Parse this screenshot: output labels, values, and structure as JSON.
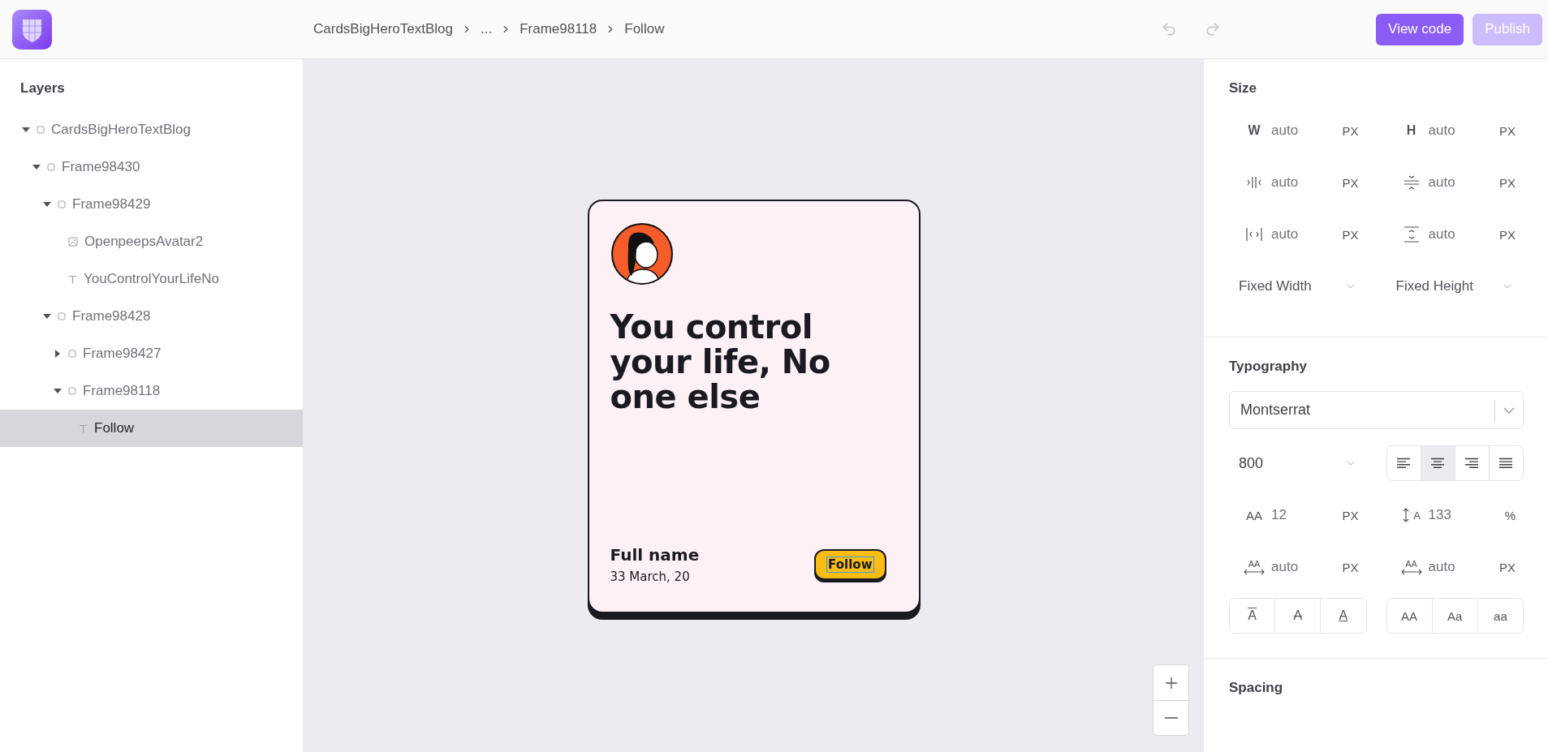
{
  "topbar": {
    "breadcrumbs": [
      "CardsBigHeroTextBlog",
      "...",
      "Frame98118",
      "Follow"
    ],
    "history": [
      {
        "kind": "undo",
        "disabled": true
      },
      {
        "kind": "redo",
        "disabled": true
      }
    ],
    "buttons": [
      {
        "label": "View code",
        "disabled": false
      },
      {
        "label": "Publish",
        "disabled": true
      }
    ]
  },
  "layers": {
    "title": "Layers",
    "items": [
      {
        "label": "CardsBigHeroTextBlog",
        "kind": "frame",
        "expanded": true,
        "selected": false,
        "children": [
          {
            "label": "Frame98430",
            "kind": "frame",
            "expanded": true,
            "selected": false,
            "children": [
              {
                "label": "Frame98429",
                "kind": "frame",
                "expanded": true,
                "selected": false,
                "children": [
                  {
                    "label": "OpenpeepsAvatar2",
                    "kind": "image",
                    "selected": false
                  },
                  {
                    "label": "YouControlYourLifeNo",
                    "kind": "text",
                    "selected": false
                  }
                ]
              },
              {
                "label": "Frame98428",
                "kind": "frame",
                "expanded": true,
                "selected": false,
                "children": [
                  {
                    "label": "Frame98427",
                    "kind": "frame",
                    "expanded": false,
                    "selected": false
                  },
                  {
                    "label": "Frame98118",
                    "kind": "frame",
                    "expanded": true,
                    "selected": false,
                    "children": [
                      {
                        "label": "Follow",
                        "kind": "text",
                        "selected": true
                      }
                    ]
                  }
                ]
              }
            ]
          }
        ]
      }
    ]
  },
  "card": {
    "heading": "You control your life, No one else",
    "name": "Full name",
    "date": "33 March, 20",
    "button": "Follow"
  },
  "zoom": [
    {
      "kind": "plus"
    },
    {
      "kind": "minus"
    }
  ],
  "properties": {
    "size": {
      "title": "Size",
      "fields": [
        {
          "kind": "text",
          "label": "W",
          "value": "auto",
          "unit": "PX"
        },
        {
          "kind": "text",
          "label": "H",
          "value": "auto",
          "unit": "PX"
        },
        {
          "kind": "minwidth",
          "value": "auto",
          "unit": "PX"
        },
        {
          "kind": "minheight",
          "value": "auto",
          "unit": "PX"
        },
        {
          "kind": "maxwidth",
          "value": "auto",
          "unit": "PX"
        },
        {
          "kind": "maxheight",
          "value": "auto",
          "unit": "PX"
        }
      ],
      "dropdowns": [
        "Fixed Width",
        "Fixed Height"
      ]
    },
    "typography": {
      "title": "Typography",
      "font": "Montserrat",
      "weight": "800",
      "align": [
        {
          "kind": "left",
          "selected": false
        },
        {
          "kind": "center",
          "selected": true
        },
        {
          "kind": "right",
          "selected": false
        },
        {
          "kind": "justify",
          "selected": false
        }
      ],
      "fields": [
        {
          "kind": "fontsize",
          "label": "AA",
          "value": "12",
          "unit": "PX"
        },
        {
          "kind": "lineheight",
          "label": "A",
          "value": "133",
          "unit": "%"
        },
        {
          "kind": "spacing",
          "label": "AA",
          "value": "auto",
          "unit": "PX"
        },
        {
          "kind": "spacing",
          "label": "AA",
          "value": "auto",
          "unit": "PX"
        }
      ],
      "decoration": [
        {
          "kind": "overline",
          "label": "A",
          "selected": false
        },
        {
          "kind": "strike",
          "label": "A",
          "selected": false
        },
        {
          "kind": "underline",
          "label": "A",
          "selected": false
        }
      ],
      "case": [
        {
          "label": "AA",
          "selected": false
        },
        {
          "label": "Aa",
          "selected": false
        },
        {
          "label": "aa",
          "selected": false
        }
      ]
    },
    "spacing": {
      "title": "Spacing"
    }
  }
}
